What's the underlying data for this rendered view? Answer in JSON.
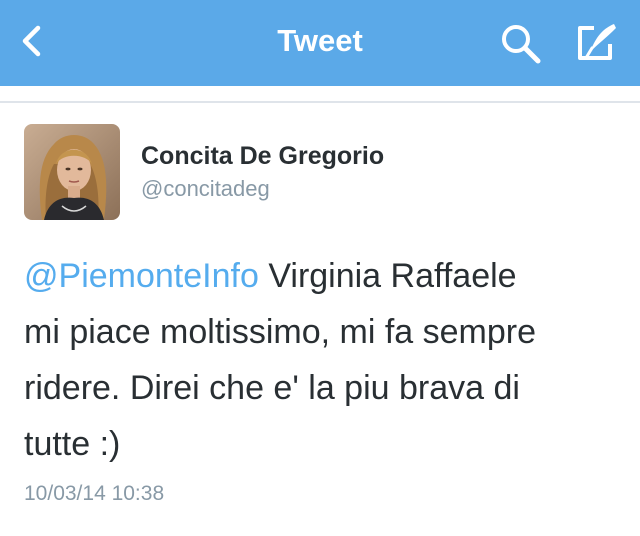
{
  "navbar": {
    "title": "Tweet",
    "background_color": "#5ba9e8",
    "back_icon": "chevron-left-icon",
    "search_icon": "search-icon",
    "compose_icon": "compose-tweet-icon"
  },
  "tweet": {
    "author": {
      "display_name": "Concita De Gregorio",
      "handle": "@concitadeg",
      "avatar": "profile-photo"
    },
    "mention": "@PiemonteInfo",
    "text_line1": " Virginia Raffaele",
    "text_line2": "mi piace moltissimo, mi fa sempre",
    "text_line3": "ridere. Direi che e' la piu brava di",
    "text_line4": "tutte :)",
    "timestamp": "10/03/14 10:38"
  },
  "colors": {
    "link": "#55acee",
    "text": "#292f33",
    "secondary_text": "#8899a6"
  }
}
